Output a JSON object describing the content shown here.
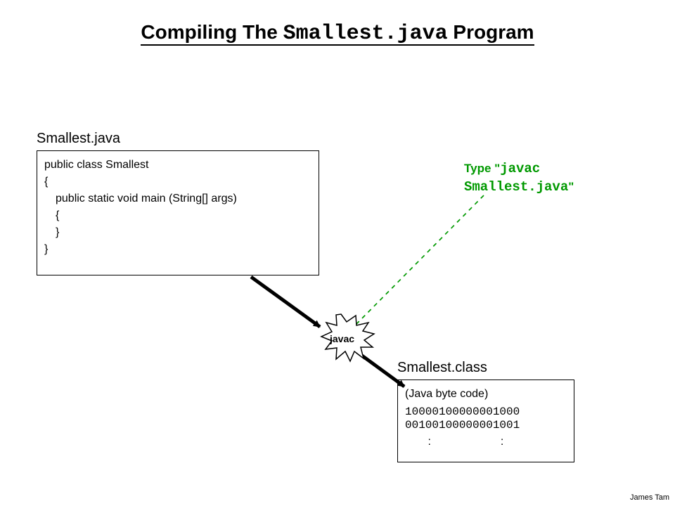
{
  "title": {
    "pre": "Compiling The ",
    "mono": "Smallest.java",
    "post": " Program"
  },
  "source": {
    "label": "Smallest.java",
    "lines": {
      "l0": "public class Smallest",
      "l1": "{",
      "l2": "public static void main (String[] args)",
      "l3": "{",
      "l4": "}",
      "l5": "}"
    }
  },
  "annotation": {
    "type_prefix": "Type ",
    "q1": "\"",
    "command1": "javac",
    "command2": "Smallest.java",
    "q2": "\""
  },
  "compiler_node": "javac",
  "output": {
    "label": "Smallest.class",
    "header": "(Java byte code)",
    "bits1": "10000100000001000",
    "bits2": "00100100000001001",
    "colon": ":"
  },
  "footer": "James Tam"
}
